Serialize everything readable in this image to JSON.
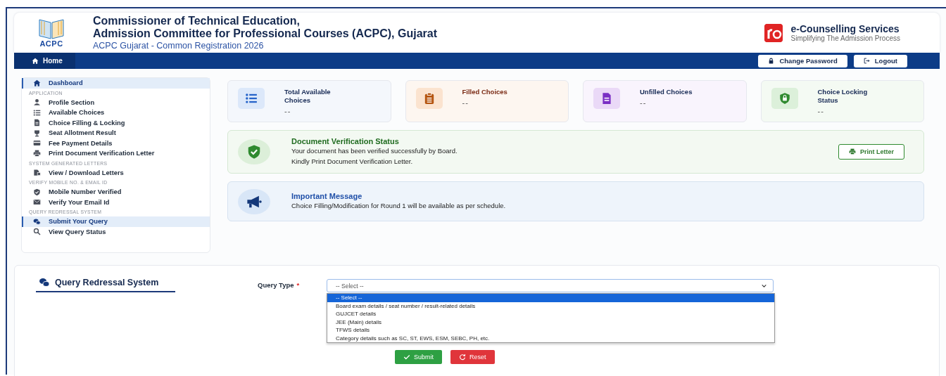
{
  "header": {
    "logo_text": "ACPC",
    "title_line_1": "Commissioner of Technical Education,",
    "title_line_2": "Admission Committee for Professional Courses (ACPC), Gujarat",
    "subtitle": "ACPC Gujarat - Common Registration 2026",
    "brand_name": "e-Counselling Services",
    "brand_tagline": "Simplifying The Admission Process"
  },
  "navbar": {
    "home": "Home",
    "buttons": [
      "Change Password",
      "Logout"
    ]
  },
  "sidebar": {
    "sections": [
      {
        "items": [
          {
            "label": "Dashboard",
            "selected": true
          }
        ]
      },
      {
        "heading": "APPLICATION",
        "items": [
          {
            "label": "Profile Section",
            "selected": false
          },
          {
            "label": "Available Choices",
            "selected": false
          },
          {
            "label": "Choice Filling & Locking",
            "selected": false
          },
          {
            "label": "Seat Allotment Result",
            "selected": false
          },
          {
            "label": "Fee Payment Details",
            "selected": false
          },
          {
            "label": "Print Document Verification Letter",
            "selected": false
          }
        ]
      },
      {
        "heading": "SYSTEM GENERATED LETTERS",
        "items": [
          {
            "label": "View / Download Letters",
            "selected": false
          }
        ]
      },
      {
        "heading": "VERIFY MOBILE NO. & EMAIL ID",
        "items": [
          {
            "label": "Mobile Number Verified",
            "selected": false
          },
          {
            "label": "Verify Your Email Id",
            "selected": false
          }
        ]
      },
      {
        "heading": "QUERY REDRESSAL SYSTEM",
        "items": [
          {
            "label": "Submit Your Query",
            "selected": true
          },
          {
            "label": "View Query Status",
            "selected": false
          }
        ]
      }
    ]
  },
  "stats": [
    {
      "label": "Total Available Choices",
      "value": "--",
      "color": "#2563c9"
    },
    {
      "label": "Filled Choices",
      "value": "--",
      "color": "#b5540f"
    },
    {
      "label": "Unfilled Choices",
      "value": "--",
      "color": "#7a2fc4"
    },
    {
      "label": "Choice Locking Status",
      "value": "--",
      "color": "#2f8a2f"
    }
  ],
  "verification": {
    "title": "Document Verification Status",
    "lines": [
      "Your document has been verified successfully by Board.",
      "Kindly Print Document Verification Letter."
    ],
    "button": "Print Letter"
  },
  "message": {
    "title": "Important Message",
    "text": "Choice Filling/Modification for Round 1 will be available as per schedule."
  },
  "query": {
    "title": "Query Redressal System",
    "field_label": "Query Type",
    "required_mark": "*",
    "value": "-- Select --",
    "options": [
      {
        "label": "-- Select --",
        "selected": true
      },
      {
        "label": "Board exam details / seat number / result-related details",
        "selected": false
      },
      {
        "label": "GUJCET details",
        "selected": false
      },
      {
        "label": "JEE (Main) details",
        "selected": false
      },
      {
        "label": "TFWS details",
        "selected": false
      },
      {
        "label": "Category details such as SC, ST, EWS, ESM, SEBC, PH, etc.",
        "selected": false
      }
    ],
    "buttons": [
      "Submit",
      "Reset"
    ]
  }
}
